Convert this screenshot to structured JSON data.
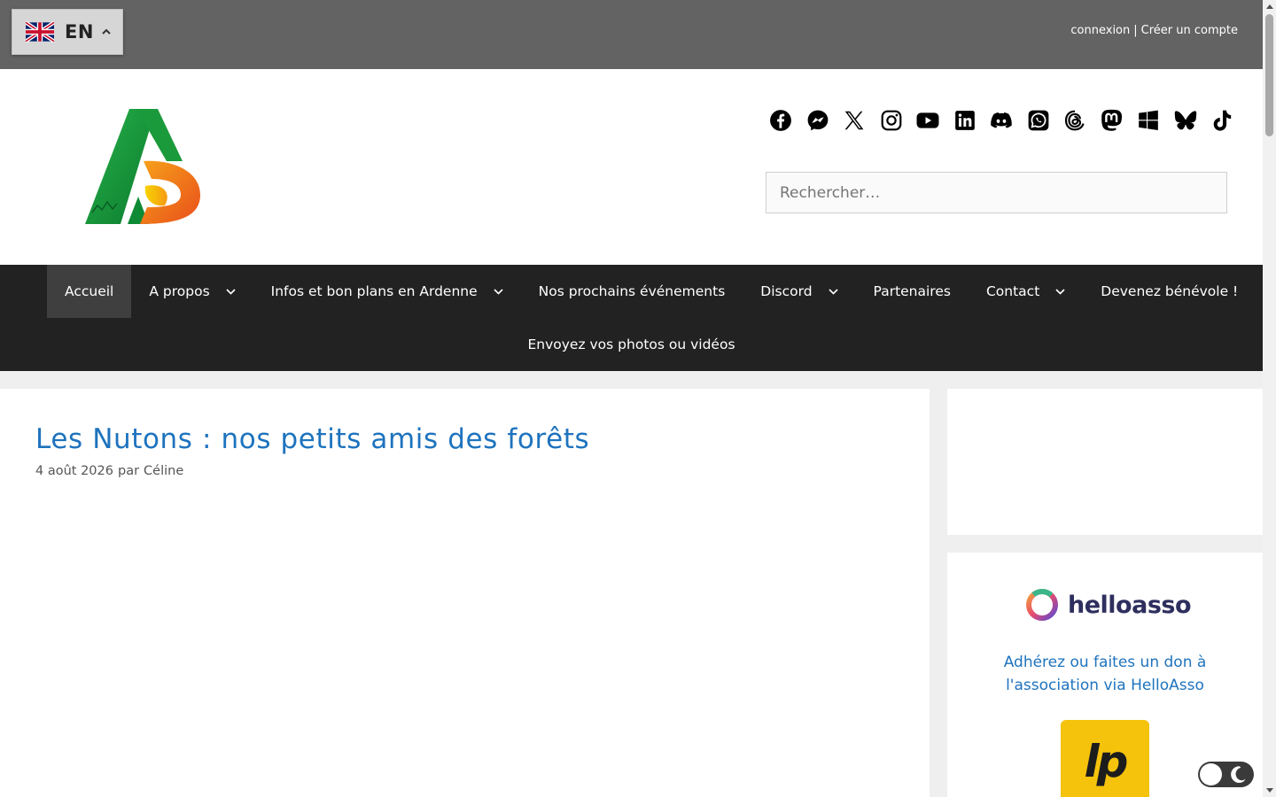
{
  "language": {
    "code": "EN",
    "flag": "uk-flag-icon"
  },
  "auth": {
    "login": "connexion",
    "separator": "|",
    "register": "Créer un compte"
  },
  "social_icons": [
    "facebook-icon",
    "messenger-icon",
    "x-icon",
    "instagram-icon",
    "youtube-icon",
    "linkedin-icon",
    "discord-icon",
    "whatsapp-icon",
    "threads-icon",
    "mastodon-icon",
    "windows-icon",
    "bluesky-icon",
    "tiktok-icon"
  ],
  "search": {
    "placeholder": "Rechercher…"
  },
  "nav": {
    "items": [
      {
        "label": "Accueil"
      },
      {
        "label": "A propos"
      },
      {
        "label": "Infos et bon plans en Ardenne"
      },
      {
        "label": "Nos prochains événements"
      },
      {
        "label": "Discord"
      },
      {
        "label": "Partenaires"
      },
      {
        "label": "Contact"
      },
      {
        "label": "Devenez bénévole !"
      },
      {
        "label": "Envoyez vos photos ou vidéos"
      }
    ]
  },
  "post": {
    "title": "Les Nutons : nos petits amis des forêts",
    "date": "4 août 2026",
    "by": "par",
    "author": "Céline"
  },
  "sidebar": {
    "helloasso_brand": "helloasso",
    "helloasso_link": "Adhérez ou faites un don à l'association via HelloAsso",
    "lp_logo": "lp"
  },
  "colors": {
    "topbar": "#636363",
    "nav": "#222222",
    "link": "#1e73be",
    "accent_green": "#1a9a3a",
    "accent_orange": "#f07a1e"
  }
}
